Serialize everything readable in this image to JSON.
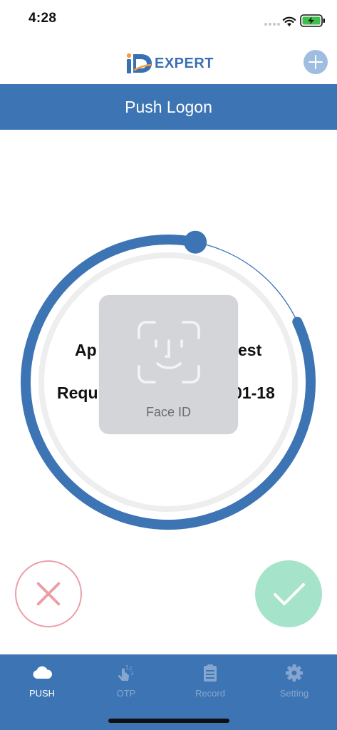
{
  "status_bar": {
    "time": "4:28",
    "icons": [
      "signal-dots-icon",
      "wifi-icon",
      "battery-charging-icon"
    ],
    "battery_color": "#3fbf4a"
  },
  "header": {
    "logo_text": "EXPERT",
    "logo_icon": "id-logo-icon",
    "add_icon": "plus-icon",
    "brand_color": "#3d74b4"
  },
  "title_bar": {
    "title": "Push Logon"
  },
  "request": {
    "line1_left": "Ap",
    "line1_right": "est",
    "line2_left": "Requ",
    "line2_right": "01-18",
    "countdown_remaining": 0.85
  },
  "faceid": {
    "label": "Face ID",
    "icon": "face-id-icon"
  },
  "actions": {
    "reject_icon": "close-icon",
    "accept_icon": "checkmark-icon",
    "reject_color": "#ec9ea6",
    "accept_color": "#a6e3cb"
  },
  "tabs": [
    {
      "label": "PUSH",
      "icon": "cloud-icon",
      "active": true
    },
    {
      "label": "OTP",
      "icon": "touch-otp-icon",
      "active": false
    },
    {
      "label": "Record",
      "icon": "clipboard-icon",
      "active": false
    },
    {
      "label": "Setting",
      "icon": "gear-icon",
      "active": false
    }
  ]
}
